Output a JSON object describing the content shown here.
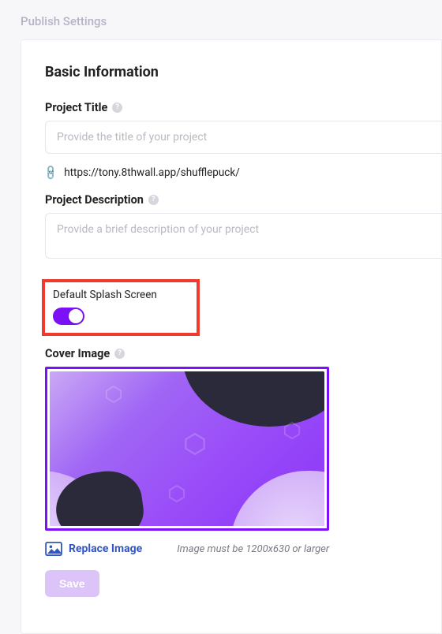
{
  "header": {
    "title": "Publish Settings"
  },
  "section": {
    "title": "Basic Information"
  },
  "projectTitle": {
    "label": "Project Title",
    "placeholder": "Provide the title of your project",
    "value": ""
  },
  "url": {
    "text": "https://tony.8thwall.app/shufflepuck/"
  },
  "projectDescription": {
    "label": "Project Description",
    "placeholder": "Provide a brief description of your project",
    "value": ""
  },
  "splash": {
    "label": "Default Splash Screen",
    "enabled": true
  },
  "coverImage": {
    "label": "Cover Image",
    "replaceLabel": "Replace Image",
    "hint": "Image must be 1200x630 or larger"
  },
  "actions": {
    "save": "Save"
  },
  "colors": {
    "accent": "#7c11f7",
    "link": "#3155c4",
    "highlight": "#ef3b2f"
  }
}
